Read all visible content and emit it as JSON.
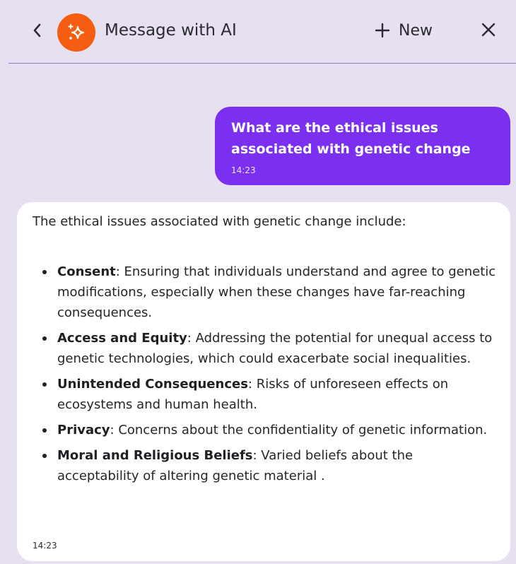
{
  "header": {
    "back_icon": "chevron-left-icon",
    "avatar_icon": "sparkle-icon",
    "avatar_color": "#f45d12",
    "title": "Message with AI",
    "new_label": "New",
    "new_icon": "plus-icon",
    "close_icon": "close-icon",
    "divider_color": "#8e7dd6"
  },
  "conversation": {
    "user_message": {
      "text": "What are the ethical issues associated with genetic change",
      "time": "14:23",
      "bubble_color": "#7b2ff0"
    },
    "ai_message": {
      "intro": "The ethical issues associated with genetic change include:",
      "items": [
        {
          "term": "Consent",
          "text": ": Ensuring that individuals understand and agree to genetic modifications, especially when these changes have far-reaching consequences."
        },
        {
          "term": "Access and Equity",
          "text": ": Addressing the potential for unequal access to genetic technologies, which could exacerbate social inequalities."
        },
        {
          "term": "Unintended Consequences",
          "text": ": Risks of unforeseen effects on ecosystems and human health."
        },
        {
          "term": "Privacy",
          "text": ": Concerns about the confidentiality of genetic information."
        },
        {
          "term": "Moral and Religious Beliefs",
          "text": ": Varied beliefs about the acceptability of altering genetic material ."
        }
      ],
      "time": "14:23"
    }
  },
  "background_color": "#e6e0f0"
}
